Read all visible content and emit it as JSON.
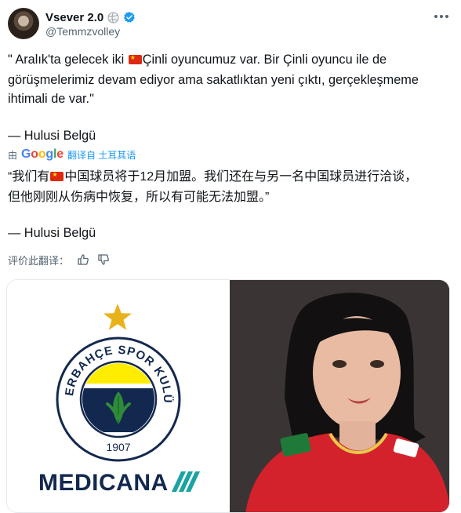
{
  "author": {
    "display_name": "Vsever 2.0",
    "handle": "@Temmzvolley",
    "avatar_icon": "user-avatar",
    "badge_icon": "volleyball-icon",
    "verified_icon": "verified-badge-icon"
  },
  "tweet": {
    "quote_tr_line1_a": "\" Aralık'ta gelecek iki ",
    "quote_tr_line1_b": "Çinli oyuncumuz var. Bir Çinli oyuncu ile de",
    "quote_tr_line2": "görüşmelerimiz devam ediyor ama sakatlıktan yeni çıktı, gerçekleşmeme",
    "quote_tr_line3": "ihtimali de var.\"",
    "attribution_tr": "— Hulusi Belgü"
  },
  "translation": {
    "by_label": "由",
    "provider": "Google",
    "from_label": "翻译自 土耳其语",
    "zh_line1_a": "“我们有",
    "zh_line1_b": "中国球员将于12月加盟。我们还在与另一名中国球员进行洽谈，",
    "zh_line2": "但他刚刚从伤病中恢复，所以有可能无法加盟。”",
    "attribution_zh": "— Hulusi Belgü",
    "rate_label": "评价此翻译：",
    "flag_color": "#de2910"
  },
  "media": {
    "left": {
      "club_name": "FENERBAHÇE SPOR KULÜBÜ",
      "club_year": "1907",
      "sponsor": "MEDICANA",
      "sponsor_color": "#13284f",
      "accent_teal": "#1aa3a1",
      "badge_yellow": "#ffed00",
      "badge_navy": "#13284f"
    },
    "right": {
      "description_icon": "player-photo",
      "jersey_color": "#d3222b",
      "sponsor_patch": "怡宝"
    }
  },
  "colors": {
    "link_blue": "#1d9bf0",
    "secondary_text": "#536471",
    "primary_text": "#0f1419"
  }
}
